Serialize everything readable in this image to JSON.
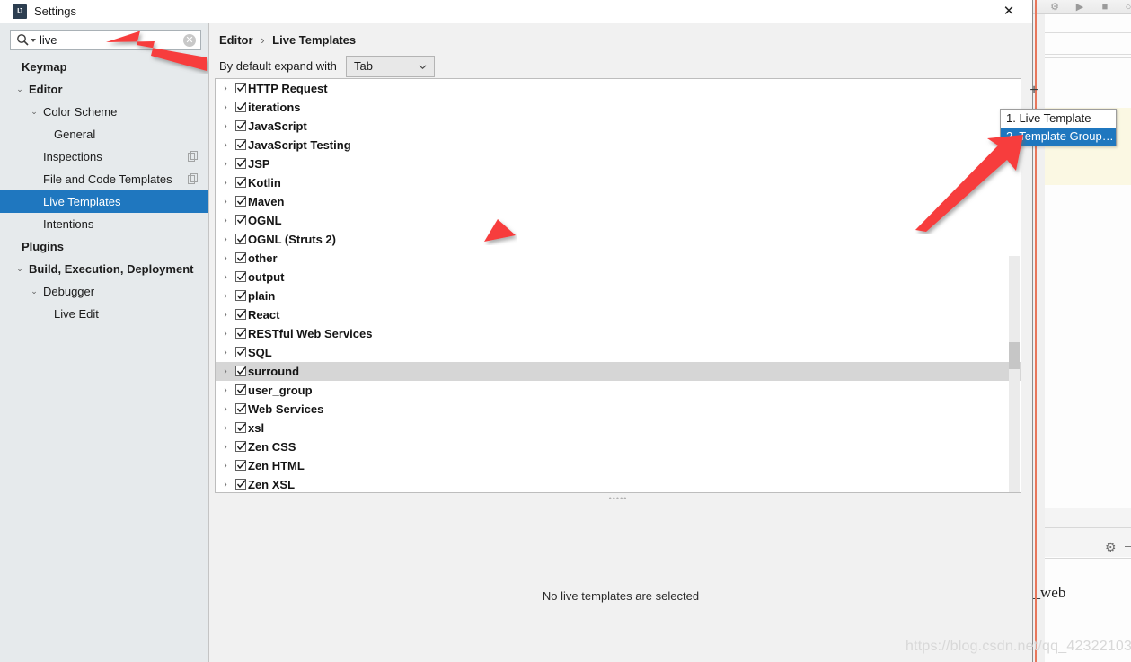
{
  "window": {
    "title": "Settings",
    "app_icon": "intellij-idea-icon",
    "close_label": "✕"
  },
  "search": {
    "value": "live",
    "placeholder": "",
    "icon": "search-icon",
    "clear_label": "✕"
  },
  "sidebar": {
    "items": [
      {
        "label": "Keymap",
        "indent": 24,
        "twisty": "",
        "bold": true,
        "selected": false,
        "copy_icon": false
      },
      {
        "label": "Editor",
        "indent": 32,
        "twisty": "⌄",
        "bold": true,
        "selected": false,
        "copy_icon": false
      },
      {
        "label": "Color Scheme",
        "indent": 48,
        "twisty": "⌄",
        "bold": false,
        "selected": false,
        "copy_icon": false
      },
      {
        "label": "General",
        "indent": 60,
        "twisty": "",
        "bold": false,
        "selected": false,
        "copy_icon": false
      },
      {
        "label": "Inspections",
        "indent": 48,
        "twisty": "",
        "bold": false,
        "selected": false,
        "copy_icon": true
      },
      {
        "label": "File and Code Templates",
        "indent": 48,
        "twisty": "",
        "bold": false,
        "selected": false,
        "copy_icon": true
      },
      {
        "label": "Live Templates",
        "indent": 48,
        "twisty": "",
        "bold": false,
        "selected": true,
        "copy_icon": false
      },
      {
        "label": "Intentions",
        "indent": 48,
        "twisty": "",
        "bold": false,
        "selected": false,
        "copy_icon": false
      },
      {
        "label": "Plugins",
        "indent": 24,
        "twisty": "",
        "bold": true,
        "selected": false,
        "copy_icon": false
      },
      {
        "label": "Build, Execution, Deployment",
        "indent": 32,
        "twisty": "⌄",
        "bold": true,
        "selected": false,
        "copy_icon": false
      },
      {
        "label": "Debugger",
        "indent": 48,
        "twisty": "⌄",
        "bold": false,
        "selected": false,
        "copy_icon": false
      },
      {
        "label": "Live Edit",
        "indent": 60,
        "twisty": "",
        "bold": false,
        "selected": false,
        "copy_icon": false
      }
    ]
  },
  "content": {
    "breadcrumb": {
      "parent": "Editor",
      "separator": "›",
      "current": "Live Templates"
    },
    "expand_with": {
      "label": "By default expand with",
      "value": "Tab"
    },
    "empty_message": "No live templates are selected",
    "toolbar": [
      {
        "name": "add-button",
        "glyph": "+"
      },
      {
        "name": "remove-button",
        "glyph": "−"
      },
      {
        "name": "revert-button",
        "glyph": "↺"
      }
    ],
    "groups": [
      {
        "name": "HTTP Request",
        "checked": true,
        "expanded": false,
        "highlighted": false
      },
      {
        "name": "iterations",
        "checked": true,
        "expanded": false,
        "highlighted": false
      },
      {
        "name": "JavaScript",
        "checked": true,
        "expanded": false,
        "highlighted": false
      },
      {
        "name": "JavaScript Testing",
        "checked": true,
        "expanded": false,
        "highlighted": false
      },
      {
        "name": "JSP",
        "checked": true,
        "expanded": false,
        "highlighted": false
      },
      {
        "name": "Kotlin",
        "checked": true,
        "expanded": false,
        "highlighted": false
      },
      {
        "name": "Maven",
        "checked": true,
        "expanded": false,
        "highlighted": false
      },
      {
        "name": "OGNL",
        "checked": true,
        "expanded": false,
        "highlighted": false
      },
      {
        "name": "OGNL (Struts 2)",
        "checked": true,
        "expanded": false,
        "highlighted": false
      },
      {
        "name": "other",
        "checked": true,
        "expanded": false,
        "highlighted": false
      },
      {
        "name": "output",
        "checked": true,
        "expanded": false,
        "highlighted": false
      },
      {
        "name": "plain",
        "checked": true,
        "expanded": false,
        "highlighted": false
      },
      {
        "name": "React",
        "checked": true,
        "expanded": false,
        "highlighted": false
      },
      {
        "name": "RESTful Web Services",
        "checked": true,
        "expanded": false,
        "highlighted": false
      },
      {
        "name": "SQL",
        "checked": true,
        "expanded": false,
        "highlighted": false
      },
      {
        "name": "surround",
        "checked": true,
        "expanded": false,
        "highlighted": true
      },
      {
        "name": "user_group",
        "checked": true,
        "expanded": false,
        "highlighted": false
      },
      {
        "name": "Web Services",
        "checked": true,
        "expanded": false,
        "highlighted": false
      },
      {
        "name": "xsl",
        "checked": true,
        "expanded": false,
        "highlighted": false
      },
      {
        "name": "Zen CSS",
        "checked": true,
        "expanded": false,
        "highlighted": false
      },
      {
        "name": "Zen HTML",
        "checked": true,
        "expanded": false,
        "highlighted": false
      },
      {
        "name": "Zen XSL",
        "checked": true,
        "expanded": false,
        "highlighted": false
      }
    ]
  },
  "popup_menu": {
    "items": [
      {
        "label": "1. Live Template",
        "selected": false
      },
      {
        "label": "2. Template Group…",
        "selected": true
      }
    ]
  },
  "background": {
    "code_text": "n_web",
    "gear_icon": "gear-icon"
  },
  "watermark": "https://blog.csdn.net/qq_42322103",
  "colors": {
    "selection_blue": "#1f77bf",
    "annotation_red": "#f73c3c",
    "dialog_bg": "#e6eaec",
    "content_bg": "#f1f1f1",
    "stripe_orange": "#e8775c"
  }
}
